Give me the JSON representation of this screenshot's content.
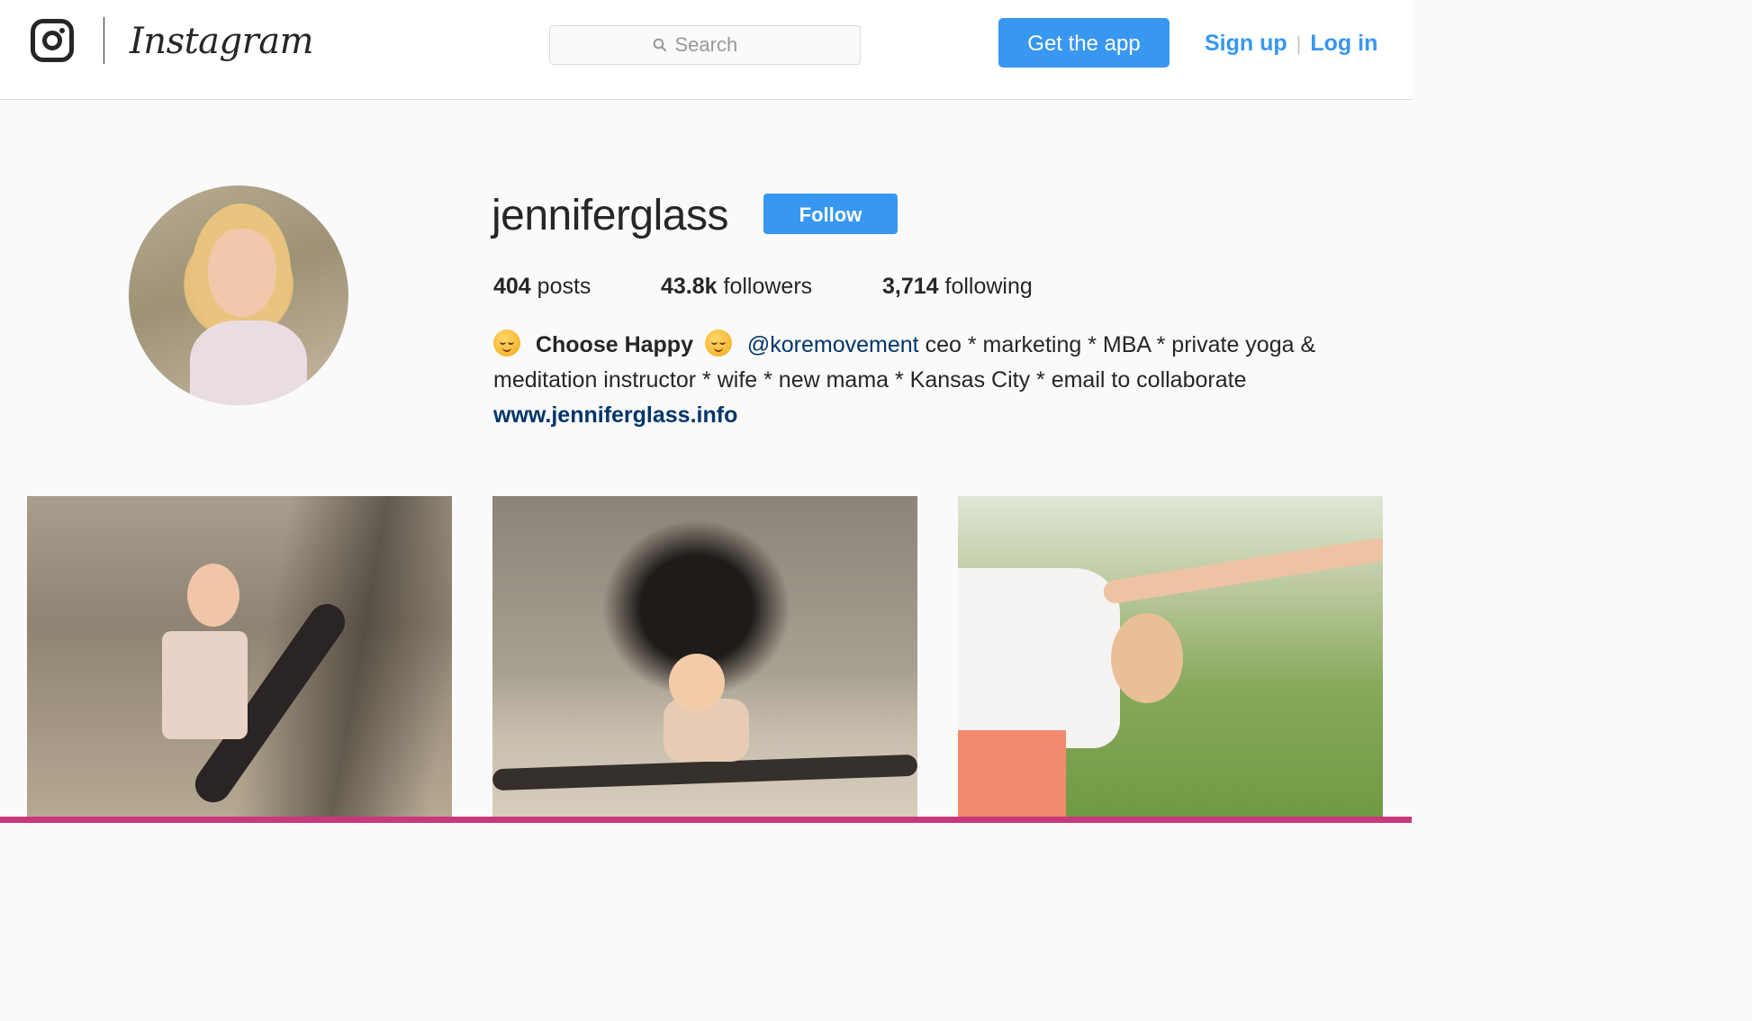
{
  "header": {
    "logo_text": "Instagram",
    "search_placeholder": "Search",
    "get_app_label": "Get the app",
    "sign_up_label": "Sign up",
    "separator": "|",
    "log_in_label": "Log in"
  },
  "profile": {
    "username": "jenniferglass",
    "follow_label": "Follow",
    "stats": [
      {
        "count": "404",
        "label": "posts"
      },
      {
        "count": "43.8k",
        "label": "followers"
      },
      {
        "count": "3,714",
        "label": "following"
      }
    ],
    "bio": {
      "name": "Choose Happy",
      "mention": "@koremovement",
      "text": "ceo * marketing * MBA * private yoga & meditation instructor * wife * new mama * Kansas City * email to collaborate",
      "website": "www.jenniferglass.info"
    },
    "emoji_icon": "relieved-face-emoji"
  },
  "posts": [
    {
      "alt": "yoga pose by rock wall"
    },
    {
      "alt": "seated splits on sand"
    },
    {
      "alt": "side angle pose in park"
    }
  ],
  "colors": {
    "accent": "#3897f0",
    "link": "#003569",
    "text": "#262626",
    "background": "#fafafa"
  }
}
